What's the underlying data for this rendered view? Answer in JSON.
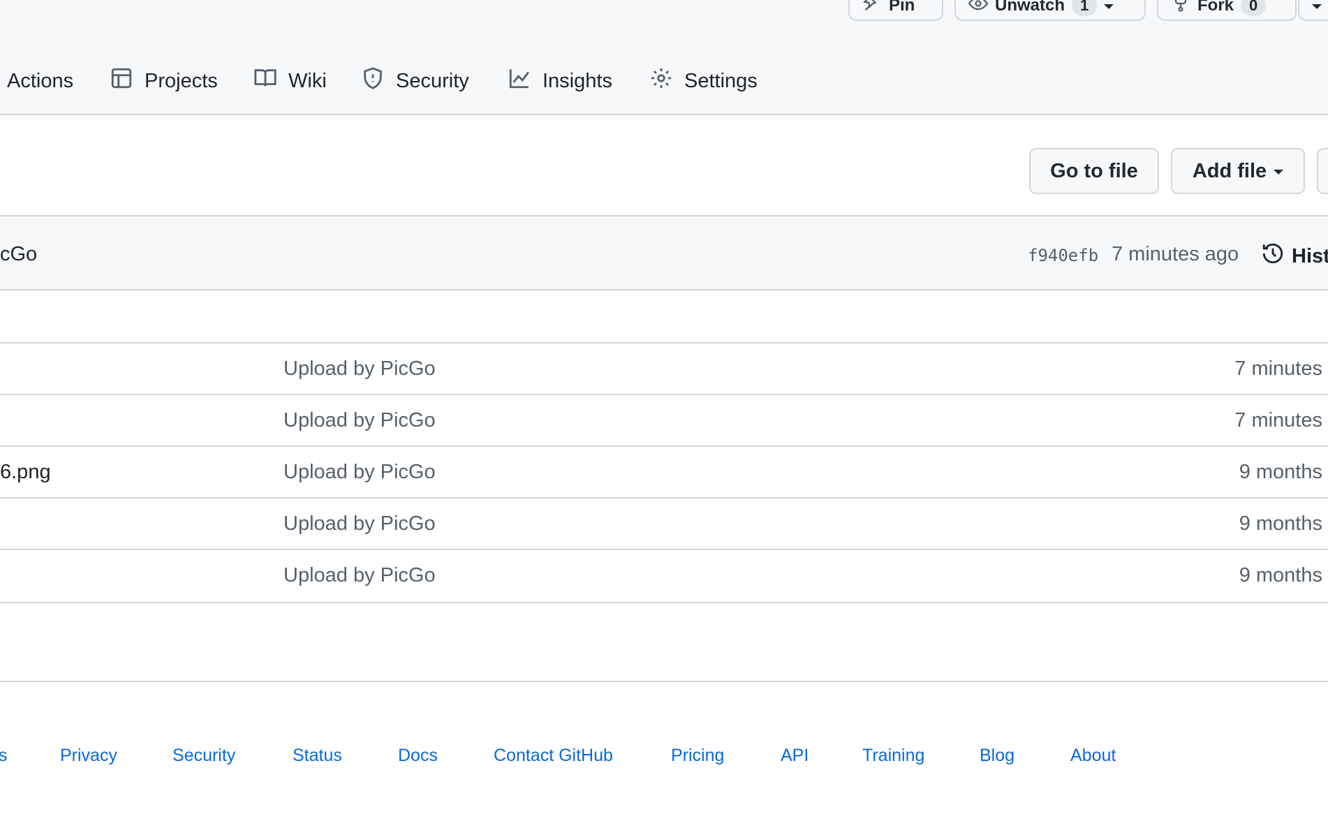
{
  "header": {
    "pin_label": "Pin",
    "unwatch_label": "Unwatch",
    "unwatch_count": "1",
    "fork_label": "Fork",
    "fork_count": "0"
  },
  "nav": {
    "items": [
      {
        "label": "Actions",
        "icon": "play-icon"
      },
      {
        "label": "Projects",
        "icon": "table-icon"
      },
      {
        "label": "Wiki",
        "icon": "book-icon"
      },
      {
        "label": "Security",
        "icon": "shield-icon"
      },
      {
        "label": "Insights",
        "icon": "graph-icon"
      },
      {
        "label": "Settings",
        "icon": "gear-icon"
      }
    ]
  },
  "toolbar": {
    "go_to_file": "Go to file",
    "add_file": "Add file"
  },
  "commit": {
    "message": "cGo",
    "sha": "f940efb",
    "time": "7 minutes ago",
    "history_label": "Hist"
  },
  "files": [
    {
      "name": "",
      "message": "Upload by PicGo",
      "age": "7 minutes"
    },
    {
      "name": "",
      "message": "Upload by PicGo",
      "age": "7 minutes"
    },
    {
      "name": "6.png",
      "message": "Upload by PicGo",
      "age": "9 months"
    },
    {
      "name": "",
      "message": "Upload by PicGo",
      "age": "9 months"
    },
    {
      "name": "",
      "message": "Upload by PicGo",
      "age": "9 months"
    }
  ],
  "footer": {
    "links": [
      "s",
      "Privacy",
      "Security",
      "Status",
      "Docs",
      "Contact GitHub",
      "Pricing",
      "API",
      "Training",
      "Blog",
      "About"
    ]
  },
  "colors": {
    "link": "#0969da",
    "muted": "#57606a",
    "border": "#d0d7de",
    "band": "#f6f8fa"
  }
}
